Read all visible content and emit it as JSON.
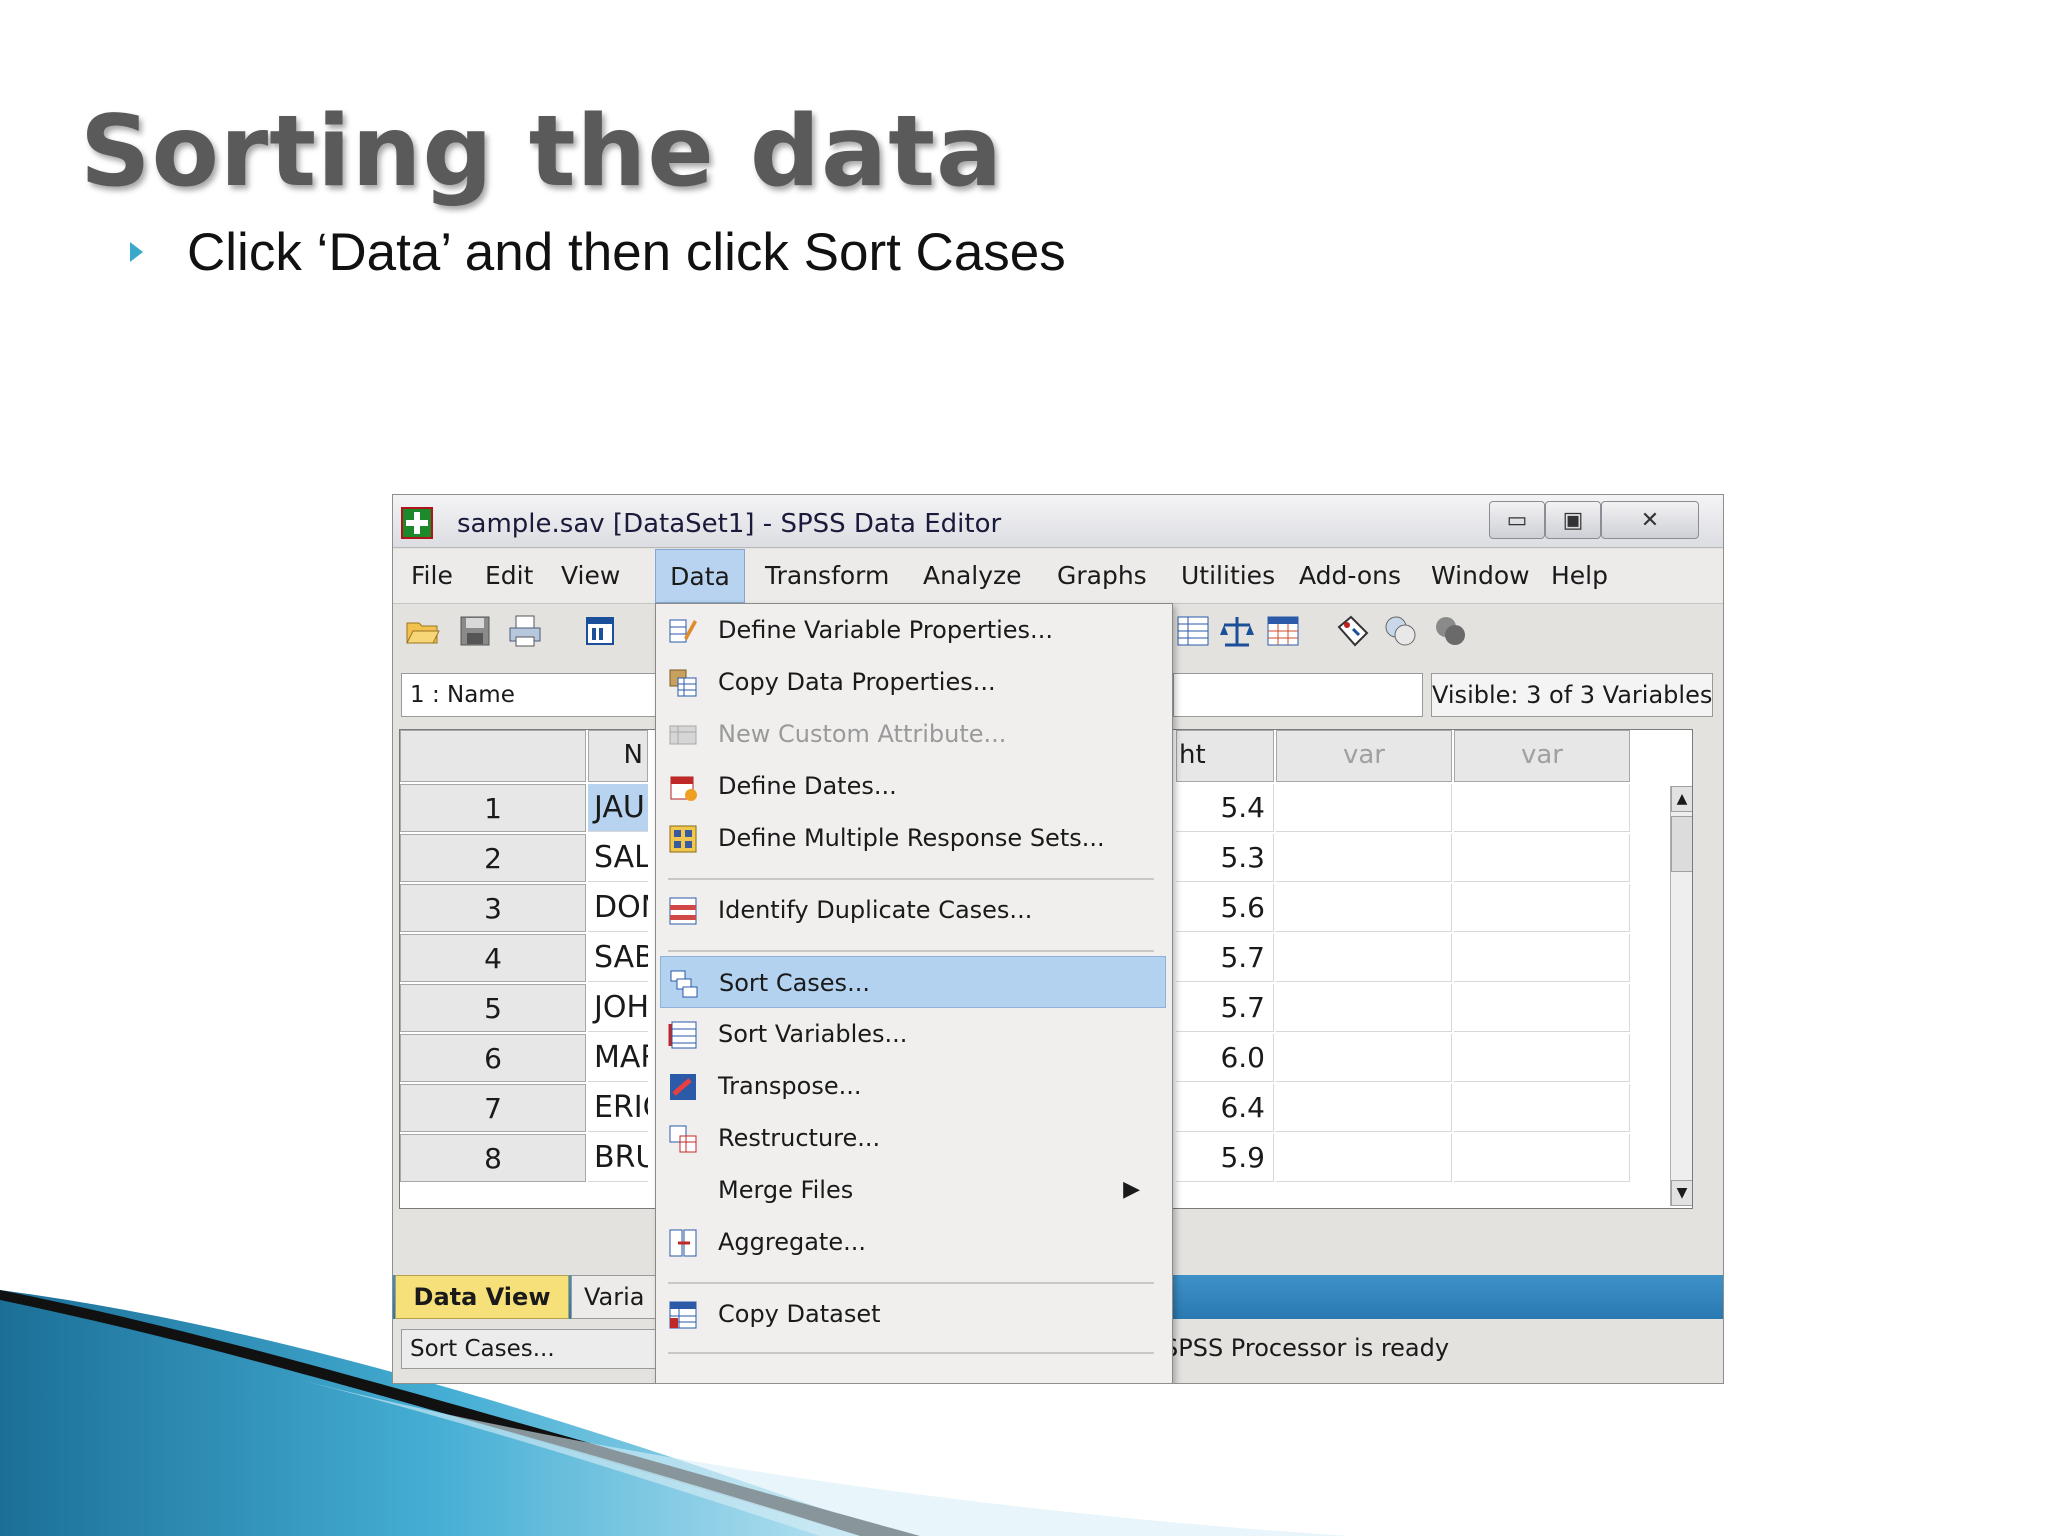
{
  "slide": {
    "title": "Sorting the data",
    "bullet": "Click ‘Data’ and then click Sort Cases"
  },
  "window": {
    "title": "sample.sav [DataSet1] - SPSS Data Editor",
    "minimize": "▭",
    "maximize": "▣",
    "close": "✕"
  },
  "menubar": [
    "File",
    "Edit",
    "View",
    "Data",
    "Transform",
    "Analyze",
    "Graphs",
    "Utilities",
    "Add-ons",
    "Window",
    "Help"
  ],
  "active_menu": "Data",
  "cell_ref": "1 : Name",
  "visible_vars": "Visible: 3 of 3 Variables",
  "grid": {
    "name_header": "N",
    "value_header": "ht",
    "var_headers": [
      "var",
      "var"
    ],
    "rows": [
      {
        "n": "1",
        "name": "JAU",
        "value": "5.4"
      },
      {
        "n": "2",
        "name": "SAL",
        "value": "5.3"
      },
      {
        "n": "3",
        "name": "DON",
        "value": "5.6"
      },
      {
        "n": "4",
        "name": "SAB",
        "value": "5.7"
      },
      {
        "n": "5",
        "name": "JOH",
        "value": "5.7"
      },
      {
        "n": "6",
        "name": "MAR",
        "value": "6.0"
      },
      {
        "n": "7",
        "name": "ERIC",
        "value": "6.4"
      },
      {
        "n": "8",
        "name": "BRU",
        "value": "5.9"
      }
    ]
  },
  "tabs": {
    "data_view": "Data View",
    "variable_view": "Varia"
  },
  "status": {
    "left": "Sort Cases...",
    "right": "SPSS  Processor is ready"
  },
  "dropdown": [
    {
      "label": "Define Variable Properties...",
      "icon": "define-variable-icon"
    },
    {
      "label": "Copy Data Properties...",
      "icon": "copy-properties-icon"
    },
    {
      "label": "New Custom Attribute...",
      "icon": "custom-attribute-icon",
      "disabled": true
    },
    {
      "label": "Define Dates...",
      "icon": "calendar-icon"
    },
    {
      "label": "Define Multiple Response Sets...",
      "icon": "response-sets-icon"
    },
    {
      "label": "Identify Duplicate Cases...",
      "icon": "duplicate-cases-icon"
    },
    {
      "label": "Sort Cases...",
      "icon": "sort-cases-icon",
      "highlighted": true
    },
    {
      "label": "Sort Variables...",
      "icon": "sort-variables-icon"
    },
    {
      "label": "Transpose...",
      "icon": "transpose-icon"
    },
    {
      "label": "Restructure...",
      "icon": "restructure-icon"
    },
    {
      "label": "Merge Files",
      "submenu": true
    },
    {
      "label": "Aggregate...",
      "icon": "aggregate-icon"
    },
    {
      "label": "Copy Dataset",
      "icon": "copy-dataset-icon"
    }
  ],
  "colors": {
    "accent": "#3aa8c8",
    "highlight": "#b2d2ef",
    "tab_active": "#f6e07a",
    "title_text": "#5a5a5a"
  }
}
